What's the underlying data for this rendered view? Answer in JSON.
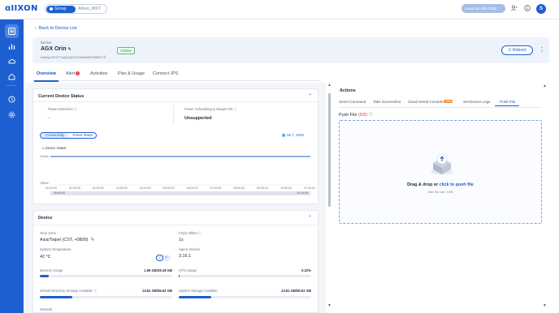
{
  "topbar": {
    "logo": "ɑIIXON",
    "scope_group": "Group",
    "scope_org": "Allxon_MKT",
    "level_up": "Level Up with OOB",
    "avatar_initial": "S"
  },
  "back_link": "Back to Device List",
  "device": {
    "label": "Device",
    "name": "AGX Orin",
    "id": "#AAfpU7K2TTuiQhJpDTfL2AA5087935D3",
    "status": "Online",
    "reboot": "Reboot"
  },
  "tabs": [
    "Overview",
    "Alert",
    "Activities",
    "Plan & Usage",
    "Connect JPS"
  ],
  "alert_count": "1",
  "status_panel": {
    "title": "Current Device Status",
    "power_detection_label": "Power Detection",
    "power_detection_value": "-",
    "power_schedule_label": "Power Scheduling & Always ON",
    "power_schedule_value": "Unsupported",
    "pill_connectivity": "Connectivity",
    "pill_power": "Power Status",
    "date": "Jul 7, 2025",
    "chart_title": "Device Status",
    "y_online": "Online",
    "y_offline": "Offline",
    "x_ticks": [
      "00:00:00",
      "01:00:00",
      "02:00:00",
      "03:00:00",
      "04:00:00",
      "05:00:00",
      "06:00:00",
      "07:00:00",
      "08:00:00",
      "09:00:00",
      "10:00:00",
      "11:00:00"
    ],
    "range_start": "00:00:00",
    "range_end": "11:14:34"
  },
  "device_panel": {
    "title": "Device",
    "tz_label": "Time Zone",
    "tz_value": "Asia/Taipei (CST, +0800)",
    "clock_label": "Clock Offset",
    "clock_value": "1s",
    "temp_label": "System Temperature",
    "temp_value": "42 °C",
    "unit_c": "°C",
    "unit_f": "°F",
    "agent_label": "Agent Version",
    "agent_value": "3.16.1",
    "mem_label": "Memory Usage",
    "mem_value": "1.96 GB/29.18 GB",
    "mem_fraction": 0.067,
    "cpu_label": "CPU Usage",
    "cpu_value": "0.22%",
    "cpu_fraction": 0.0022,
    "dir_label": "Default Directory Storage Available",
    "dir_value": "13.81 GB/56.62 GB",
    "dir_fraction": 0.244,
    "sys_label": "System Storage Available",
    "sys_value": "13.81 GB/56.62 GB",
    "sys_fraction": 0.244,
    "bottom_label": "Network"
  },
  "actions": {
    "title": "Actions",
    "tabs": [
      "Send Command",
      "Take Screenshot",
      "Cloud Serial Console",
      "Set Device Logs",
      "Push File"
    ],
    "new_badge": "Beta",
    "push_file_label": "Push File",
    "push_file_count": "(5/5)",
    "drop_text": "Drag & drop or",
    "drop_link": "click to push file",
    "max_size": "Max file size: 1GB"
  },
  "colors": {
    "brand": "#1d5fd1",
    "online": "#2f9a5e",
    "alert": "#e0363b"
  }
}
